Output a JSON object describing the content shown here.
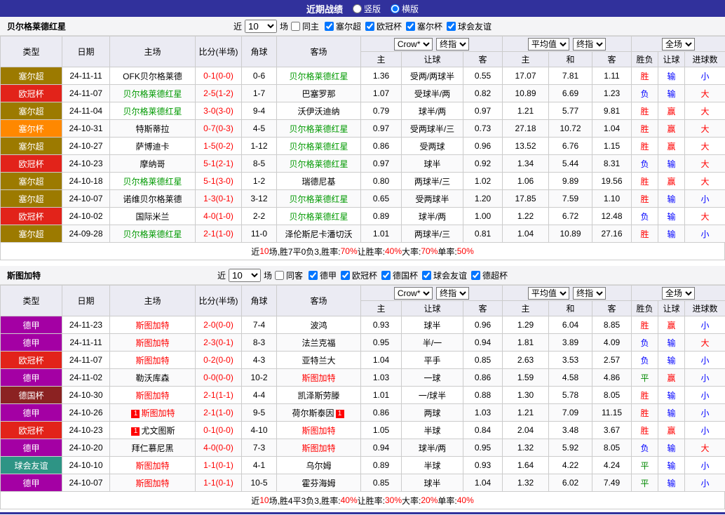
{
  "topbar": {
    "title": "近期战绩",
    "vertical": "竖版",
    "horizontal": "横版",
    "selected": "横版"
  },
  "colors": {
    "topbar": "#31319c",
    "header_bg": "#ebebf3",
    "score": "#ff0000",
    "border": "#cccccc"
  },
  "table_header": {
    "type": "类型",
    "date": "日期",
    "home": "主场",
    "score": "比分(半场)",
    "corner": "角球",
    "away": "客场",
    "company": "Crow*",
    "final": "终指",
    "average": "平均值",
    "full": "全场",
    "home_short": "主",
    "away_short": "客",
    "draw": "和",
    "handicap": "让球",
    "wdl": "胜负",
    "goals": "进球数"
  },
  "league_colors": {
    "塞尔超": "#9c7a00",
    "欧冠杯": "#e2231a",
    "塞尔杯": "#ff8800",
    "德甲": "#a400a4",
    "德国杯": "#8b2222",
    "球会友谊": "#2e9485"
  },
  "result_colors": {
    "胜": "#ff0000",
    "负": "#0000ff",
    "平": "#008800",
    "赢": "#ff0000",
    "输": "#0000ff",
    "大": "#ff0000",
    "小": "#0000ff"
  },
  "sections": [
    {
      "team": "贝尔格莱德红星",
      "team_color": "#009900",
      "filters": {
        "near": "近",
        "count": "10",
        "games": "场",
        "same": "同主",
        "same_checked": false,
        "leagues": [
          {
            "label": "塞尔超",
            "checked": true
          },
          {
            "label": "欧冠杯",
            "checked": true
          },
          {
            "label": "塞尔杯",
            "checked": true
          },
          {
            "label": "球会友谊",
            "checked": true
          }
        ]
      },
      "rows": [
        {
          "league": "塞尔超",
          "date": "24-11-11",
          "home": "OFK贝尔格莱德",
          "score": "0-1(0-0)",
          "corner": "0-6",
          "away": "贝尔格莱德红星",
          "away_hl": true,
          "o1": "1.36",
          "hc": "受两/两球半",
          "o2": "0.55",
          "m1": "17.07",
          "m2": "7.81",
          "m3": "1.11",
          "r": [
            "胜",
            "输",
            "小"
          ]
        },
        {
          "league": "欧冠杯",
          "date": "24-11-07",
          "home": "贝尔格莱德红星",
          "home_hl": true,
          "score": "2-5(1-2)",
          "corner": "1-7",
          "away": "巴塞罗那",
          "o1": "1.07",
          "hc": "受球半/两",
          "o2": "0.82",
          "m1": "10.89",
          "m2": "6.69",
          "m3": "1.23",
          "r": [
            "负",
            "输",
            "大"
          ]
        },
        {
          "league": "塞尔超",
          "date": "24-11-04",
          "home": "贝尔格莱德红星",
          "home_hl": true,
          "score": "3-0(3-0)",
          "corner": "9-4",
          "away": "沃伊沃迪纳",
          "o1": "0.79",
          "hc": "球半/两",
          "o2": "0.97",
          "m1": "1.21",
          "m2": "5.77",
          "m3": "9.81",
          "r": [
            "胜",
            "赢",
            "大"
          ]
        },
        {
          "league": "塞尔杯",
          "date": "24-10-31",
          "home": "特斯蒂拉",
          "score": "0-7(0-3)",
          "corner": "4-5",
          "away": "贝尔格莱德红星",
          "away_hl": true,
          "o1": "0.97",
          "hc": "受两球半/三",
          "o2": "0.73",
          "m1": "27.18",
          "m2": "10.72",
          "m3": "1.04",
          "r": [
            "胜",
            "赢",
            "大"
          ]
        },
        {
          "league": "塞尔超",
          "date": "24-10-27",
          "home": "萨博迪卡",
          "score": "1-5(0-2)",
          "corner": "1-12",
          "away": "贝尔格莱德红星",
          "away_hl": true,
          "o1": "0.86",
          "hc": "受两球",
          "o2": "0.96",
          "m1": "13.52",
          "m2": "6.76",
          "m3": "1.15",
          "r": [
            "胜",
            "赢",
            "大"
          ]
        },
        {
          "league": "欧冠杯",
          "date": "24-10-23",
          "home": "摩纳哥",
          "score": "5-1(2-1)",
          "corner": "8-5",
          "away": "贝尔格莱德红星",
          "away_hl": true,
          "o1": "0.97",
          "hc": "球半",
          "o2": "0.92",
          "m1": "1.34",
          "m2": "5.44",
          "m3": "8.31",
          "r": [
            "负",
            "输",
            "大"
          ]
        },
        {
          "league": "塞尔超",
          "date": "24-10-18",
          "home": "贝尔格莱德红星",
          "home_hl": true,
          "score": "5-1(3-0)",
          "corner": "1-2",
          "away": "瑞德尼基",
          "o1": "0.80",
          "hc": "两球半/三",
          "o2": "1.02",
          "m1": "1.06",
          "m2": "9.89",
          "m3": "19.56",
          "r": [
            "胜",
            "赢",
            "大"
          ]
        },
        {
          "league": "塞尔超",
          "date": "24-10-07",
          "home": "诺维贝尔格莱德",
          "score": "1-3(0-1)",
          "corner": "3-12",
          "away": "贝尔格莱德红星",
          "away_hl": true,
          "o1": "0.65",
          "hc": "受两球半",
          "o2": "1.20",
          "m1": "17.85",
          "m2": "7.59",
          "m3": "1.10",
          "r": [
            "胜",
            "输",
            "小"
          ]
        },
        {
          "league": "欧冠杯",
          "date": "24-10-02",
          "home": "国际米兰",
          "score": "4-0(1-0)",
          "corner": "2-2",
          "away": "贝尔格莱德红星",
          "away_hl": true,
          "o1": "0.89",
          "hc": "球半/两",
          "o2": "1.00",
          "m1": "1.22",
          "m2": "6.72",
          "m3": "12.48",
          "r": [
            "负",
            "输",
            "大"
          ]
        },
        {
          "league": "塞尔超",
          "date": "24-09-28",
          "home": "贝尔格莱德红星",
          "home_hl": true,
          "score": "2-1(1-0)",
          "corner": "11-0",
          "away": "泽伦斯尼卡潘切沃",
          "o1": "1.01",
          "hc": "两球半/三",
          "o2": "0.81",
          "m1": "1.04",
          "m2": "10.89",
          "m3": "27.16",
          "r": [
            "胜",
            "输",
            "小"
          ]
        }
      ],
      "summary": [
        {
          "t": "近",
          "red": false
        },
        {
          "t": "10",
          "red": true
        },
        {
          "t": "场,胜7平0负3, ",
          "red": false
        },
        {
          "t": "胜率:",
          "red": false
        },
        {
          "t": "70%",
          "red": true
        },
        {
          "t": " 让胜率:",
          "red": false
        },
        {
          "t": "40%",
          "red": true
        },
        {
          "t": " 大率:",
          "red": false
        },
        {
          "t": "70%",
          "red": true
        },
        {
          "t": " 单率:",
          "red": false
        },
        {
          "t": "50%",
          "red": true
        }
      ]
    },
    {
      "team": "斯图加特",
      "team_color": "#ff0000",
      "filters": {
        "near": "近",
        "count": "10",
        "games": "场",
        "same": "同客",
        "same_checked": false,
        "leagues": [
          {
            "label": "德甲",
            "checked": true
          },
          {
            "label": "欧冠杯",
            "checked": true
          },
          {
            "label": "德国杯",
            "checked": true
          },
          {
            "label": "球会友谊",
            "checked": true
          },
          {
            "label": "德超杯",
            "checked": true
          }
        ]
      },
      "rows": [
        {
          "league": "德甲",
          "date": "24-11-23",
          "home": "斯图加特",
          "home_hl": true,
          "score": "2-0(0-0)",
          "corner": "7-4",
          "away": "波鸿",
          "o1": "0.93",
          "hc": "球半",
          "o2": "0.96",
          "m1": "1.29",
          "m2": "6.04",
          "m3": "8.85",
          "r": [
            "胜",
            "赢",
            "小"
          ]
        },
        {
          "league": "德甲",
          "date": "24-11-11",
          "home": "斯图加特",
          "home_hl": true,
          "score": "2-3(0-1)",
          "corner": "8-3",
          "away": "法兰克福",
          "o1": "0.95",
          "hc": "半/一",
          "o2": "0.94",
          "m1": "1.81",
          "m2": "3.89",
          "m3": "4.09",
          "r": [
            "负",
            "输",
            "大"
          ]
        },
        {
          "league": "欧冠杯",
          "date": "24-11-07",
          "home": "斯图加特",
          "home_hl": true,
          "score": "0-2(0-0)",
          "corner": "4-3",
          "away": "亚特兰大",
          "o1": "1.04",
          "hc": "平手",
          "o2": "0.85",
          "m1": "2.63",
          "m2": "3.53",
          "m3": "2.57",
          "r": [
            "负",
            "输",
            "小"
          ]
        },
        {
          "league": "德甲",
          "date": "24-11-02",
          "home": "勒沃库森",
          "score": "0-0(0-0)",
          "corner": "10-2",
          "away": "斯图加特",
          "away_hl": true,
          "o1": "1.03",
          "hc": "一球",
          "o2": "0.86",
          "m1": "1.59",
          "m2": "4.58",
          "m3": "4.86",
          "r": [
            "平",
            "赢",
            "小"
          ]
        },
        {
          "league": "德国杯",
          "date": "24-10-30",
          "home": "斯图加特",
          "home_hl": true,
          "score": "2-1(1-1)",
          "corner": "4-4",
          "away": "凯泽斯劳滕",
          "o1": "1.01",
          "hc": "一/球半",
          "o2": "0.88",
          "m1": "1.30",
          "m2": "5.78",
          "m3": "8.05",
          "r": [
            "胜",
            "输",
            "小"
          ]
        },
        {
          "league": "德甲",
          "date": "24-10-26",
          "home": "斯图加特",
          "home_hl": true,
          "home_badge": "1",
          "score": "2-1(1-0)",
          "corner": "9-5",
          "away": "荷尔斯泰因",
          "away_badge": "1",
          "o1": "0.86",
          "hc": "两球",
          "o2": "1.03",
          "m1": "1.21",
          "m2": "7.09",
          "m3": "11.15",
          "r": [
            "胜",
            "输",
            "小"
          ]
        },
        {
          "league": "欧冠杯",
          "date": "24-10-23",
          "home": "尤文图斯",
          "home_badge": "1",
          "score": "0-1(0-0)",
          "corner": "4-10",
          "away": "斯图加特",
          "away_hl": true,
          "o1": "1.05",
          "hc": "半球",
          "o2": "0.84",
          "m1": "2.04",
          "m2": "3.48",
          "m3": "3.67",
          "r": [
            "胜",
            "赢",
            "小"
          ]
        },
        {
          "league": "德甲",
          "date": "24-10-20",
          "home": "拜仁慕尼黑",
          "score": "4-0(0-0)",
          "corner": "7-3",
          "away": "斯图加特",
          "away_hl": true,
          "o1": "0.94",
          "hc": "球半/两",
          "o2": "0.95",
          "m1": "1.32",
          "m2": "5.92",
          "m3": "8.05",
          "r": [
            "负",
            "输",
            "大"
          ]
        },
        {
          "league": "球会友谊",
          "date": "24-10-10",
          "home": "斯图加特",
          "home_hl": true,
          "score": "1-1(0-1)",
          "corner": "4-1",
          "away": "乌尔姆",
          "o1": "0.89",
          "hc": "半球",
          "o2": "0.93",
          "m1": "1.64",
          "m2": "4.22",
          "m3": "4.24",
          "r": [
            "平",
            "输",
            "小"
          ]
        },
        {
          "league": "德甲",
          "date": "24-10-07",
          "home": "斯图加特",
          "home_hl": true,
          "score": "1-1(0-1)",
          "corner": "10-5",
          "away": "霍芬海姆",
          "o1": "0.85",
          "hc": "球半",
          "o2": "1.04",
          "m1": "1.32",
          "m2": "6.02",
          "m3": "7.49",
          "r": [
            "平",
            "输",
            "小"
          ]
        }
      ],
      "summary": [
        {
          "t": "近",
          "red": false
        },
        {
          "t": "10",
          "red": true
        },
        {
          "t": "场,胜4平3负3, ",
          "red": false
        },
        {
          "t": "胜率:",
          "red": false
        },
        {
          "t": "40%",
          "red": true
        },
        {
          "t": " 让胜率:",
          "red": false
        },
        {
          "t": "30%",
          "red": true
        },
        {
          "t": " 大率:",
          "red": false
        },
        {
          "t": "20%",
          "red": true
        },
        {
          "t": " 单率:",
          "red": false
        },
        {
          "t": "40%",
          "red": true
        }
      ]
    }
  ]
}
